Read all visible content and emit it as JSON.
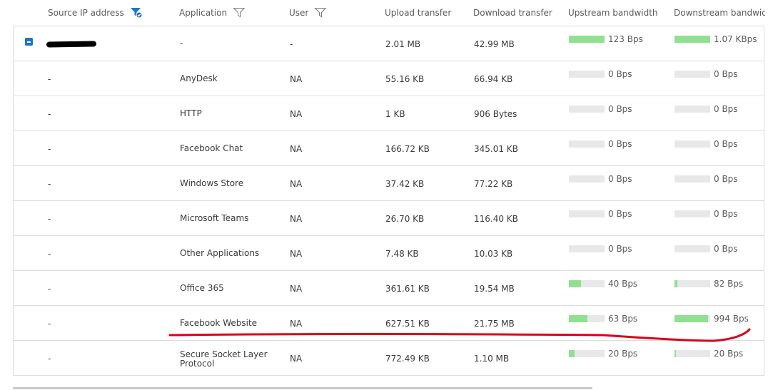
{
  "columns": {
    "source_ip": "Source IP address",
    "application": "Application",
    "user": "User",
    "upload": "Upload transfer",
    "download": "Download transfer",
    "upstream": "Upstream bandwidth",
    "downstream": "Downstream bandwidth"
  },
  "rows": [
    {
      "source": "",
      "app": "-",
      "user": "-",
      "upload": "2.01 MB",
      "download": "42.99 MB",
      "up_bw": "123 Bps",
      "up_level": 1.0,
      "down_bw": "1.07 KBps",
      "down_level": 1.0
    },
    {
      "source": "-",
      "app": "AnyDesk",
      "user": "NA",
      "upload": "55.16 KB",
      "download": "66.94 KB",
      "up_bw": "0 Bps",
      "up_level": 0,
      "down_bw": "0 Bps",
      "down_level": 0
    },
    {
      "source": "-",
      "app": "HTTP",
      "user": "NA",
      "upload": "1 KB",
      "download": "906 Bytes",
      "up_bw": "0 Bps",
      "up_level": 0,
      "down_bw": "0 Bps",
      "down_level": 0
    },
    {
      "source": "-",
      "app": "Facebook Chat",
      "user": "NA",
      "upload": "166.72 KB",
      "download": "345.01 KB",
      "up_bw": "0 Bps",
      "up_level": 0,
      "down_bw": "0 Bps",
      "down_level": 0
    },
    {
      "source": "-",
      "app": "Windows Store",
      "user": "NA",
      "upload": "37.42 KB",
      "download": "77.22 KB",
      "up_bw": "0 Bps",
      "up_level": 0,
      "down_bw": "0 Bps",
      "down_level": 0
    },
    {
      "source": "-",
      "app": "Microsoft Teams",
      "user": "NA",
      "upload": "26.70 KB",
      "download": "116.40 KB",
      "up_bw": "0 Bps",
      "up_level": 0,
      "down_bw": "0 Bps",
      "down_level": 0
    },
    {
      "source": "-",
      "app": "Other Applications",
      "user": "NA",
      "upload": "7.48 KB",
      "download": "10.03 KB",
      "up_bw": "0 Bps",
      "up_level": 0,
      "down_bw": "0 Bps",
      "down_level": 0
    },
    {
      "source": "-",
      "app": "Office 365",
      "user": "NA",
      "upload": "361.61 KB",
      "download": "19.54 MB",
      "up_bw": "40 Bps",
      "up_level": 0.33,
      "down_bw": "82 Bps",
      "down_level": 0.08
    },
    {
      "source": "-",
      "app": "Facebook Website",
      "user": "NA",
      "upload": "627.51 KB",
      "download": "21.75 MB",
      "up_bw": "63 Bps",
      "up_level": 0.51,
      "down_bw": "994 Bps",
      "down_level": 0.93
    },
    {
      "source": "-",
      "app": "Secure Socket Layer Protocol",
      "user": "NA",
      "upload": "772.49 KB",
      "download": "1.10 MB",
      "up_bw": "20 Bps",
      "up_level": 0.16,
      "down_bw": "20 Bps",
      "down_level": 0.02
    }
  ],
  "colors": {
    "bar_fill": "#90e090",
    "bar_track": "#e8e8e8",
    "filter_active": "#1f74c9",
    "annotation": "#d9001b"
  },
  "icons": {
    "source_filter": "filter-active-icon",
    "app_filter": "filter-icon",
    "user_filter": "filter-icon",
    "expander": "collapse-icon"
  }
}
